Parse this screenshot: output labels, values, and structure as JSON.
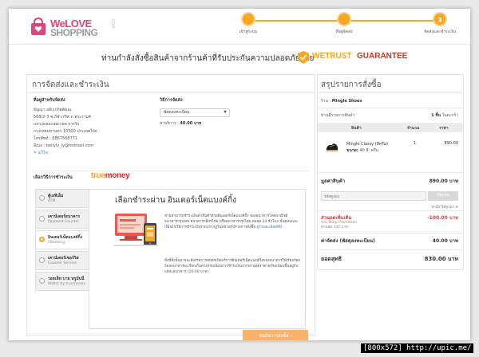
{
  "logo": {
    "line1": "WeLOVE",
    "line2": "SHOPPING",
    "dotcom": ".COM"
  },
  "steps": [
    {
      "num": "",
      "label": "เข้าสู่ระบบ"
    },
    {
      "num": "",
      "label": "ที่อยู่จัดส่ง"
    },
    {
      "num": "3",
      "label": "จัดส่งและชำระเงิน"
    }
  ],
  "trust": {
    "text": "ท่านกำลังสั่งซื้อสินค้าจากร้านค้าที่รับประกันความปลอดภัยโดย",
    "brand1": "WETRUST",
    "brand2": "GUARANTEE"
  },
  "left": {
    "title": "การจัดส่งและชำระเงิน",
    "address": {
      "heading": "ที่อยู่สำหรับจัดส่ง",
      "lines": [
        "ธัญญา อดิเรกกิตติคุณ",
        "568/2-3 ซ.กีฬากรีฑ ถ.พระราม4",
        "แขวงคลองเตย เขต บางรัก",
        "กรุงเทพมหานคร 10500 ประเทศไทย",
        "โทรศัพท์ : 0867568771",
        "อีเมล : bellyly_ly@hotmail.com"
      ],
      "edit": "แก้ไข"
    },
    "shipping": {
      "heading": "วิธีการจัดส่ง",
      "selected": "พัสดุลงทะเบียน",
      "fee_label": "ค่าบริการ :",
      "fee_value": "40.00 บาท"
    },
    "payment": {
      "label": "เลือกวิธีการชำระเงิน",
      "brand_a": "true",
      "brand_b": "money",
      "methods": [
        {
          "name": "ตู้เอทีเอ็ม",
          "desc": "ATM"
        },
        {
          "name": "เคาน์เตอร์ธนาคาร",
          "desc": "Payment Counter"
        },
        {
          "name": "อินเตอร์เน็ตแบงค์กิ้ง",
          "desc": "I-Banking"
        },
        {
          "name": "เคาน์เตอร์เซอร์วิส",
          "desc": "Counter Service"
        },
        {
          "name": "วอลเล็ท บาย ทรูมันนี่",
          "desc": "Wallet by truemoney"
        }
      ],
      "detail_title": "เลือกชำระผ่าน อินเตอร์เน็ตแบงค์กิ้ง",
      "p1": "ท่านสามารถชำระเงินค่าสินค้าด้วยอินเตอร์เน็ตแบงค์กิ้ง ของธนาคารไทยพาณิชย์ ธนาคารกรุงเทพ ธนาคารกสิกรไทย หรือธนาคารกรุงไทย ตลอด 24 ชั่วโมง ขั้นตอนและเงื่อนไขวิธีการชำระเงินรายปรากฏในหน้าสรุปรายการสั่งซื้อ",
      "p1_link": "ดูรายละเอียดที่นี่",
      "p2": "ทั้งนี้ทั้งนั้นอาจจะต้องรอการสมัครเปิดบริการอินเตอร์เน็ตแบงค์กิ้งของธนาคารให้เรียบร้อย โดยธนาคารจะเรียกเก็บค่าธรรมเนียมการชำระเงินจากท่านอัตราค่าธรรมเนียมขึ้นอยู่กับแต่ละธนาคาร (20-40 บาท)"
    },
    "confirm_label": "ยืนยันการสั่งซื้อ  ›"
  },
  "right": {
    "title": "สรุปรายการสั่งซื้อ",
    "shop_label": "ร้าน :",
    "shop_name": "Mingle Shoes",
    "count_label": "ท่านมีรายการสินค้า",
    "count_value": "1 ชิ้น",
    "count_suffix": "ในตะกร้า",
    "headers": {
      "product": "สินค้า",
      "qty": "จำนวน",
      "price": "ราคา"
    },
    "item": {
      "name": "Mingle Classy (สีครีม)",
      "size_label": "ขนาด:",
      "size_value": "40 สี: ครีม",
      "qty": "1",
      "price": "890.00"
    },
    "subtotal_label": "มูลค่าสินค้า",
    "subtotal_value": "890.00 บาท",
    "coupon_placeholder": "รหัสคูปอง",
    "coupon_button": "ใช้คูปอง",
    "cancel_coupon": "ยกเลิกใช้คูปอง",
    "discount_label": "ส่วนลดเพิ่มเติม",
    "discount_value": "-100.00 บาท",
    "discount_note1": "จาก Shop Promotion",
    "discount_note2": "ส่วนลด 100 บาท",
    "shipping_label": "ค่าจัดส่ง (พัสดุลงทะเบียน)",
    "shipping_value": "40.00 บาท",
    "total_label": "ยอดสุทธิ",
    "total_value": "830.00 บาท"
  },
  "watermark": "[800x572] http://upic.me/",
  "colors": {
    "accent": "#f5a623",
    "brand_pink": "#e0457b",
    "discount": "#e03c3c",
    "link": "#3a7bd5"
  }
}
